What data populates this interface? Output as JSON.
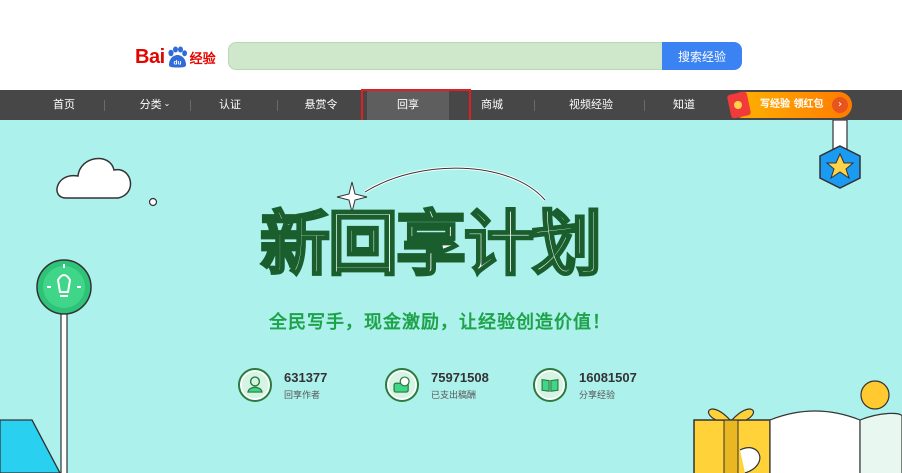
{
  "header": {
    "logo_text_bai": "Bai",
    "logo_text_du": "du",
    "logo_text_jingyan": "经验",
    "search": {
      "value": "",
      "placeholder": "",
      "button_label": "搜索经验"
    }
  },
  "nav": {
    "items": [
      {
        "label": "首页"
      },
      {
        "label": "分类"
      },
      {
        "label": "认证"
      },
      {
        "label": "悬赏令"
      },
      {
        "label": "回享",
        "active": true
      },
      {
        "label": "商城"
      },
      {
        "label": "视频经验"
      },
      {
        "label": "知道"
      }
    ],
    "dropdown_glyph": "⌄",
    "promo_label": "写经验 领红包",
    "promo_arrow": "›"
  },
  "hero": {
    "title": "新回享计划",
    "subtitle": "全民写手，现金激励，让经验创造价值！",
    "stats": [
      {
        "value": "631377",
        "label": "回享作者",
        "icon": "author-icon"
      },
      {
        "value": "75971508",
        "label": "已支出稿酬",
        "icon": "money-icon"
      },
      {
        "value": "16081507",
        "label": "分享经验",
        "icon": "book-icon"
      }
    ]
  },
  "colors": {
    "nav_bg": "#474747",
    "hero_bg": "#adf1ec",
    "accent_green": "#1ea34a",
    "search_button": "#3b82f3",
    "highlight_box": "#e02020"
  }
}
